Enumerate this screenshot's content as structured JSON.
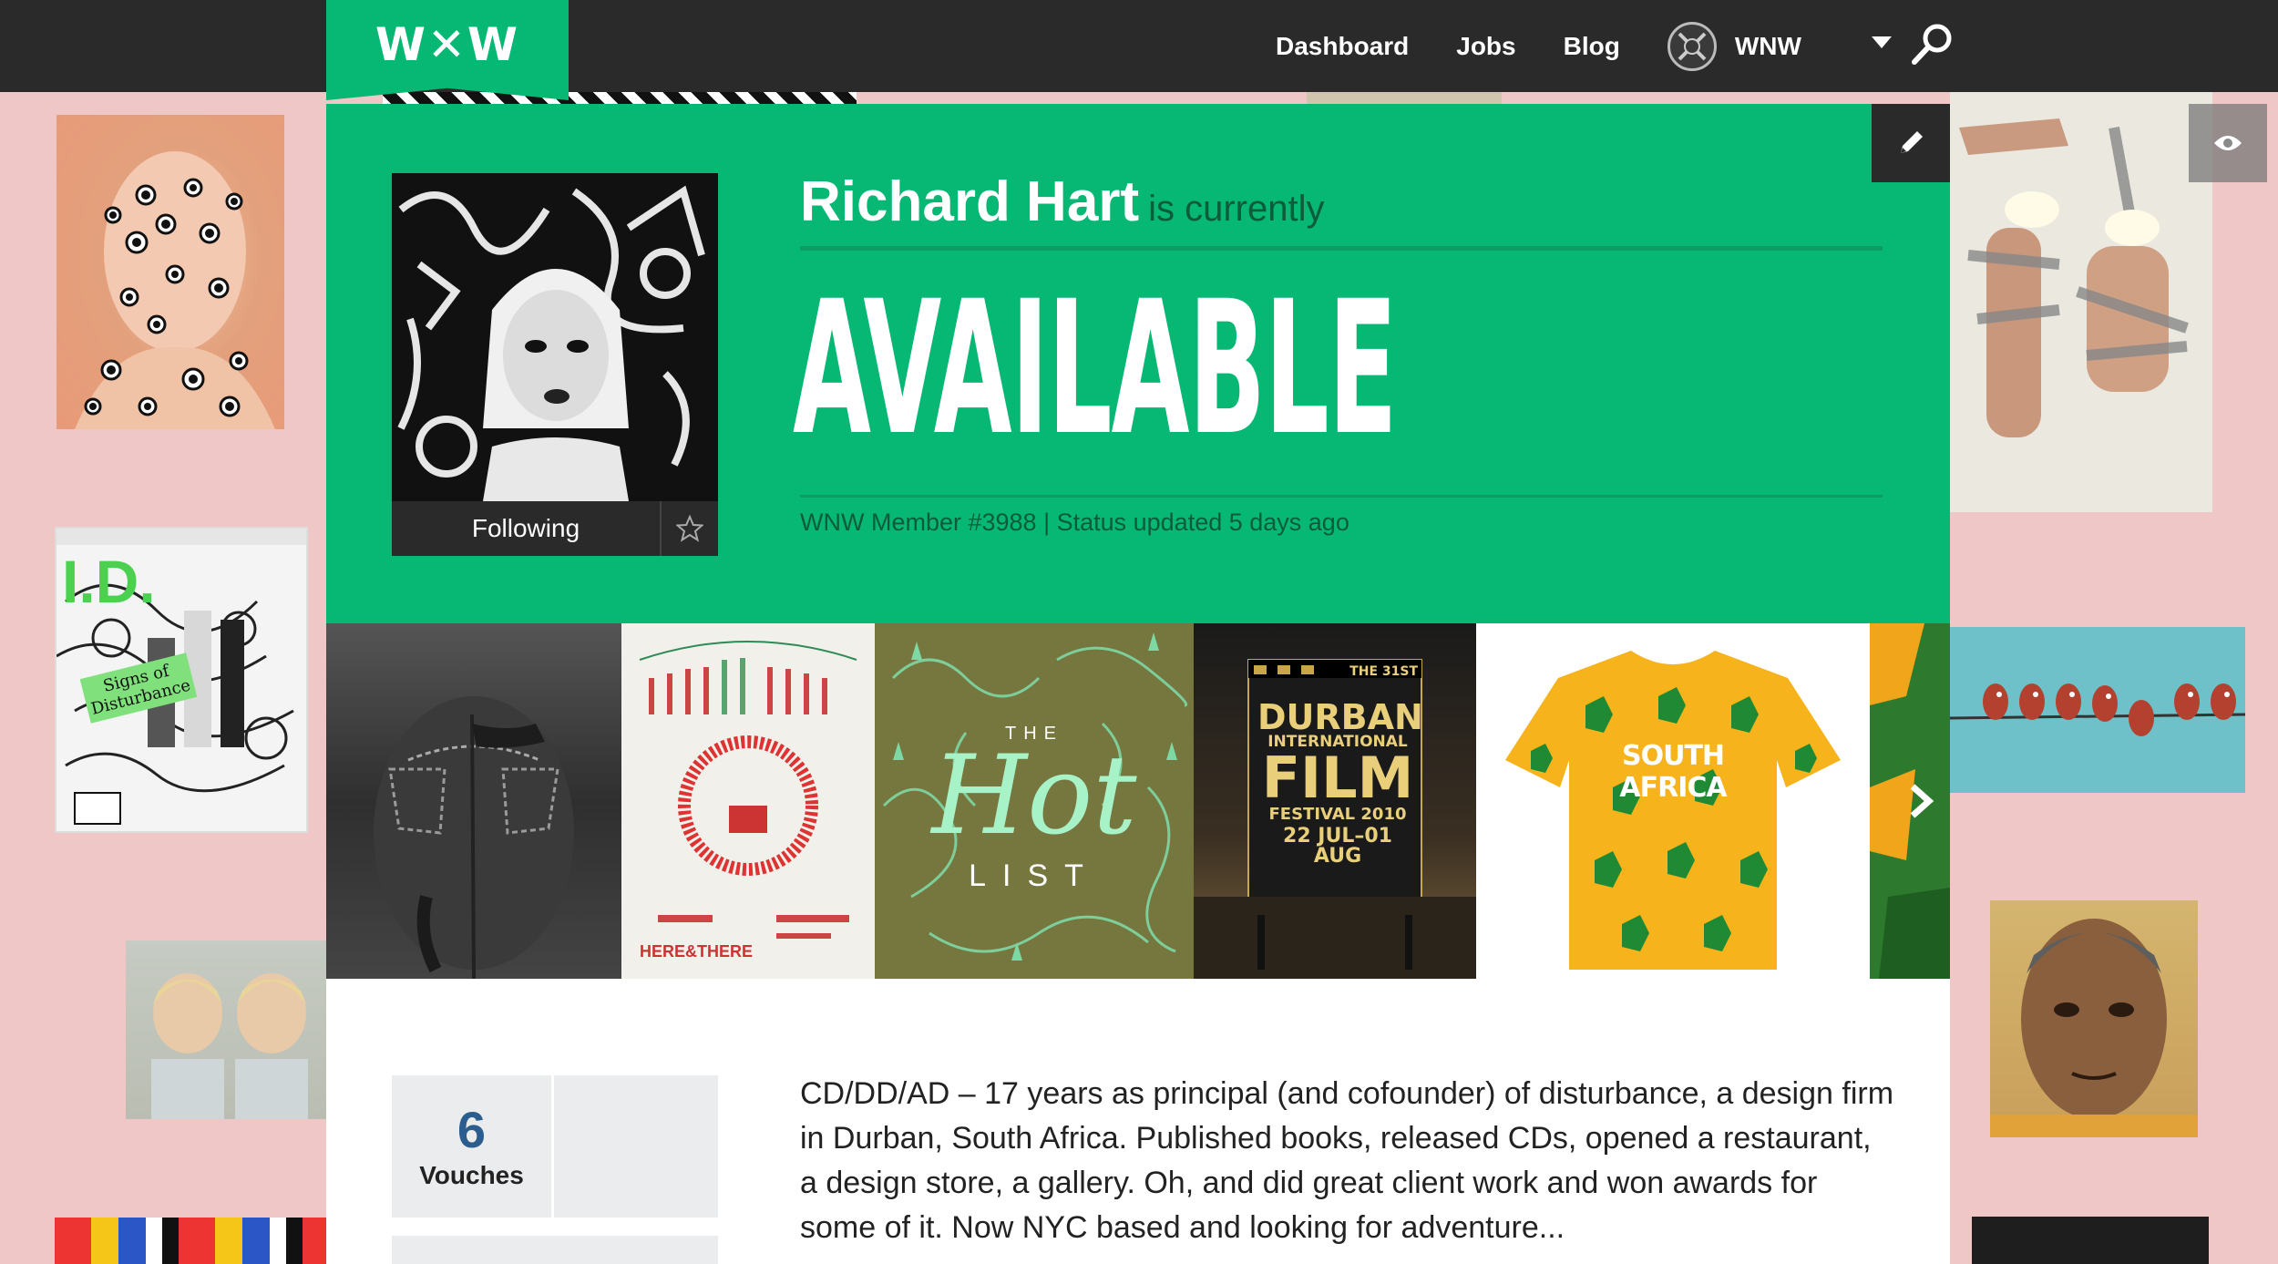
{
  "nav": {
    "logo": "W✕W",
    "links": [
      "Dashboard",
      "Jobs",
      "Blog"
    ],
    "username": "WNW"
  },
  "profile": {
    "name": "Richard Hart",
    "status_prefix": "is currently",
    "status": "AVAILABLE",
    "meta": "WNW Member #3988 | Status updated 5 days ago",
    "follow_label": "Following"
  },
  "carousel": {
    "tiles": [
      "jeans-photo",
      "hear-and-there-poster",
      "the-hot-list",
      "durban-international-film-festival-2010",
      "south-africa-tshirt",
      "green-pattern"
    ],
    "hot_list_top": "THE",
    "hot_list_main": "Hot",
    "hot_list_bottom": "LIST",
    "durban_lines": [
      "THE 31ST",
      "DURBAN",
      "INTERNATIONAL",
      "FILM",
      "FESTIVAL 2010",
      "22 JUL–01 AUG"
    ],
    "tshirt_text": "SOUTH AFRICA",
    "poster_text": "HERE&THERE"
  },
  "stats": {
    "vouches_count": "6",
    "vouches_label": "Vouches"
  },
  "bio": "CD/DD/AD – 17 years as principal (and cofounder) of disturbance, a design firm in Durban, South Africa. Published books, released CDs, opened a restaurant, a design store, a gallery. Oh, and did great client work and won awards for some of it. Now NYC based and looking for adventure...",
  "background": {
    "magazine_title": "I.D.",
    "magazine_cover_line": "Signs of Disturbance"
  },
  "colors": {
    "brand_green": "#07b774",
    "nav_dark": "#2a2a2a",
    "page_pink": "#eec7c6",
    "stat_blue": "#2b5d8e"
  }
}
